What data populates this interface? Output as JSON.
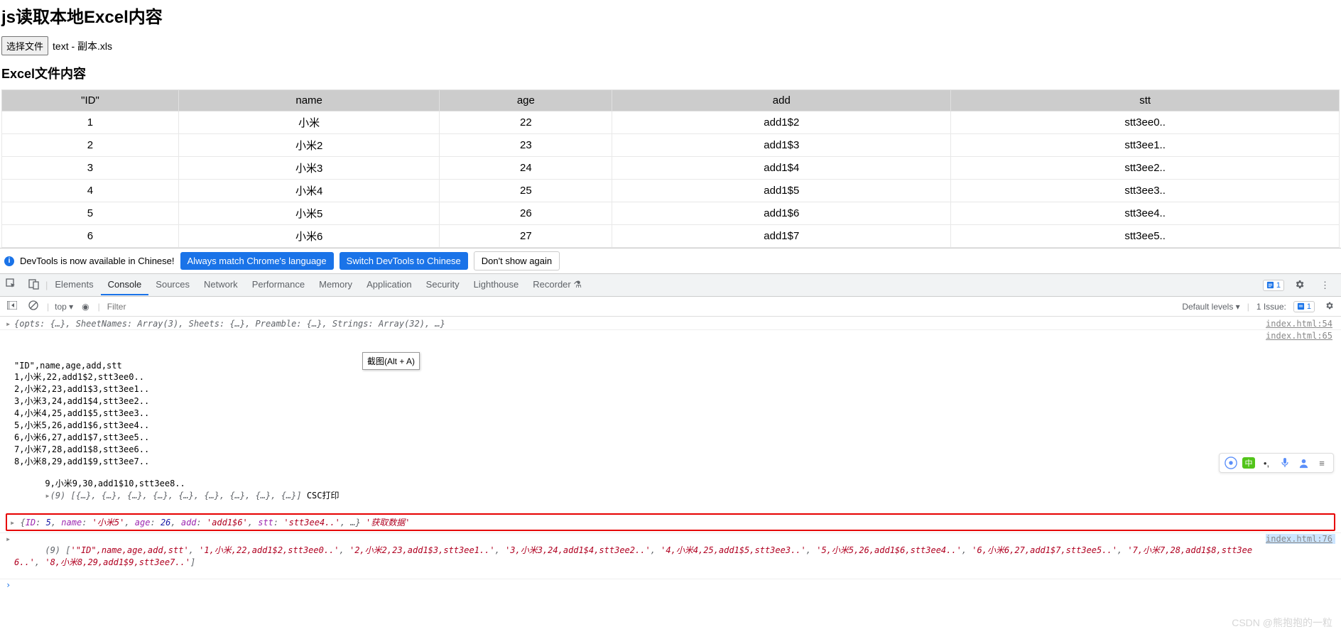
{
  "page": {
    "title": "js读取本地Excel内容",
    "chooseFileLabel": "选择文件",
    "fileName": "text - 副本.xls",
    "contentHeading": "Excel文件内容"
  },
  "table": {
    "headers": [
      "\"ID\"",
      "name",
      "age",
      "add",
      "stt"
    ],
    "rows": [
      [
        "1",
        "小米",
        "22",
        "add1$2",
        "stt3ee0.."
      ],
      [
        "2",
        "小米2",
        "23",
        "add1$3",
        "stt3ee1.."
      ],
      [
        "3",
        "小米3",
        "24",
        "add1$4",
        "stt3ee2.."
      ],
      [
        "4",
        "小米4",
        "25",
        "add1$5",
        "stt3ee3.."
      ],
      [
        "5",
        "小米5",
        "26",
        "add1$6",
        "stt3ee4.."
      ],
      [
        "6",
        "小米6",
        "27",
        "add1$7",
        "stt3ee5.."
      ]
    ]
  },
  "devtools": {
    "notice": "DevTools is now available in Chinese!",
    "btnAlways": "Always match Chrome's language",
    "btnSwitch": "Switch DevTools to Chinese",
    "btnDont": "Don't show again",
    "tabs": [
      "Elements",
      "Console",
      "Sources",
      "Network",
      "Performance",
      "Memory",
      "Application",
      "Security",
      "Lighthouse",
      "Recorder"
    ],
    "activeTab": "Console",
    "issuesCount": "1",
    "consoleToolbar": {
      "context": "top ▾",
      "filterPlaceholder": "Filter",
      "levels": "Default levels ▾",
      "issuesLabel": "1 Issue:",
      "issuesCount": "1"
    }
  },
  "console": {
    "line1": {
      "text": "{opts: {…}, SheetNames: Array(3), Sheets: {…}, Preamble: {…}, Strings: Array(32), …}",
      "source": "index.html:54"
    },
    "line2": {
      "rows": [
        "\"ID\",name,age,add,stt",
        "1,小米,22,add1$2,stt3ee0..",
        "2,小米2,23,add1$3,stt3ee1..",
        "3,小米3,24,add1$4,stt3ee2..",
        "4,小米4,25,add1$5,stt3ee3..",
        "5,小米5,26,add1$6,stt3ee4..",
        "6,小米6,27,add1$7,stt3ee5..",
        "7,小米7,28,add1$8,stt3ee6..",
        "8,小米8,29,add1$9,stt3ee7.."
      ],
      "lastRow": "9,小米9,30,add1$10,stt3ee8.. ",
      "arrayText": "(9) [{…}, {…}, {…}, {…}, {…}, {…}, {…}, {…}, {…}]",
      "suffix": " CSC打印",
      "source": "index.html:65"
    },
    "tooltip": "截图(Alt + A)",
    "highlighted": {
      "prefix": "{",
      "parts": [
        {
          "k": "ID",
          "v": "5",
          "vcolor": "blue"
        },
        {
          "k": "name",
          "v": "'小米5'",
          "vcolor": "darkred"
        },
        {
          "k": "age",
          "v": "26",
          "vcolor": "blue"
        },
        {
          "k": "add",
          "v": "'add1$6'",
          "vcolor": "darkred"
        },
        {
          "k": "stt",
          "v": "'stt3ee4..'",
          "vcolor": "darkred"
        }
      ],
      "ellipsis": ", …}",
      "label": " '获取数据'"
    },
    "line4": {
      "count": "(9) ",
      "items": [
        "'\"ID\",name,age,add,stt'",
        "'1,小米,22,add1$2,stt3ee0..'",
        "'2,小米2,23,add1$3,stt3ee1..'",
        "'3,小米3,24,add1$4,stt3ee2..'",
        "'4,小米4,25,add1$5,stt3ee3..'",
        "'5,小米5,26,add1$6,stt3ee4..'",
        "'6,小米6,27,add1$7,stt3ee5..'",
        "'7,小米7,28,add1$8,stt3ee6..'",
        "'8,小米8,29,add1$9,stt3ee7..'"
      ],
      "source": "index.html:76"
    }
  },
  "floatBar": {
    "lang": "中"
  },
  "watermark": "CSDN @熊抱抱的一粒"
}
